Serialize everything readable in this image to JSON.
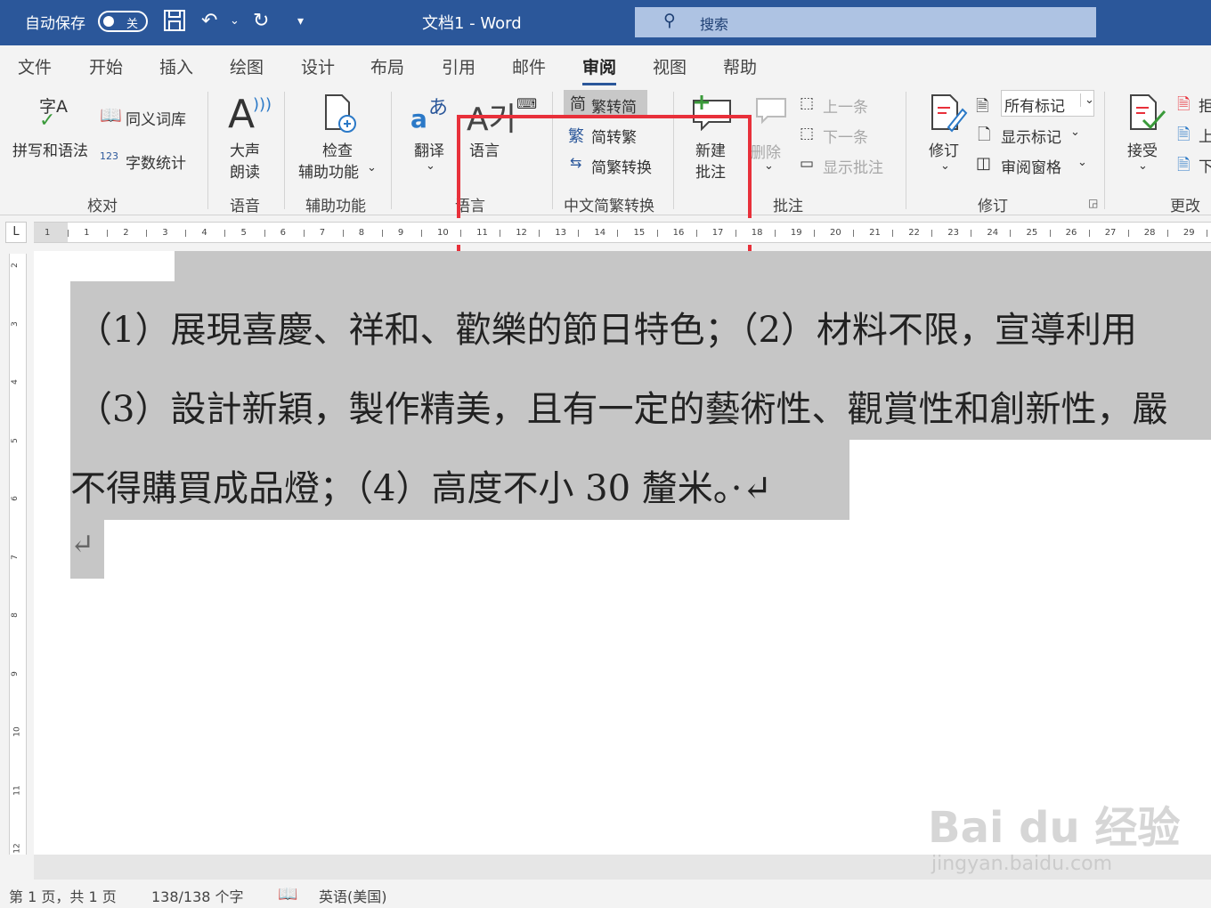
{
  "titlebar": {
    "autosave_label": "自动保存",
    "autosave_state": "关",
    "doc_title": "文档1  -  Word",
    "search_placeholder": "搜索"
  },
  "tabs": [
    "文件",
    "开始",
    "插入",
    "绘图",
    "设计",
    "布局",
    "引用",
    "邮件",
    "审阅",
    "视图",
    "帮助"
  ],
  "active_tab": "审阅",
  "ribbon": {
    "proofing": {
      "spelling": "拼写和语法",
      "spelling_icon_text": "字A",
      "thesaurus": "同义词库",
      "word_count": "字数统计",
      "word_count_icon_text": "123",
      "group": "校对"
    },
    "speech": {
      "read_aloud_1": "大声",
      "read_aloud_2": "朗读",
      "group": "语音"
    },
    "accessibility": {
      "check_1": "检查",
      "check_2": "辅助功能",
      "group": "辅助功能"
    },
    "language": {
      "translate": "翻译",
      "translate_icon_a": "a",
      "translate_icon_b": "あ",
      "language": "语言",
      "language_icon": "A가",
      "group": "语言"
    },
    "chinese": {
      "to_simplified": "繁转简",
      "to_traditional": "简转繁",
      "convert": "简繁转换",
      "icon_simp": "简",
      "icon_trad": "繁",
      "group": "中文简繁转换"
    },
    "comments": {
      "new_1": "新建",
      "new_2": "批注",
      "delete": "删除",
      "prev": "上一条",
      "next": "下一条",
      "show": "显示批注",
      "group": "批注"
    },
    "tracking": {
      "track": "修订",
      "markup_select": "所有标记",
      "show_markup": "显示标记",
      "pane": "审阅窗格",
      "group": "修订"
    },
    "changes": {
      "accept": "接受",
      "reject_partial": "拒",
      "prev_partial": "上",
      "next_partial": "下",
      "group": "更改"
    }
  },
  "ruler": {
    "corner": "L",
    "numbers": [
      "1",
      "1",
      "2",
      "3",
      "4",
      "5",
      "6",
      "7",
      "8",
      "9",
      "10",
      "11",
      "12",
      "13",
      "14",
      "15",
      "16",
      "17",
      "18",
      "19",
      "20",
      "21",
      "22",
      "23",
      "24",
      "25",
      "26",
      "27",
      "28",
      "29"
    ],
    "vnumbers": [
      "2",
      "3",
      "4",
      "5",
      "6",
      "7",
      "8",
      "9",
      "10",
      "11",
      "12"
    ]
  },
  "document": {
    "line1": "（1）展現喜慶、祥和、歡樂的節日特色；（2）材料不限，宣導利用",
    "line2": "（3）設計新穎，製作精美，且有一定的藝術性、觀賞性和創新性，嚴",
    "line3": "不得購買成品燈；（4）高度不小 30 釐米。·↵",
    "line4": "↵"
  },
  "status": {
    "page": "第 1 页，共 1 页",
    "words": "138/138 个字",
    "language": "英语(美国)"
  },
  "watermark": {
    "brand": "Bai du 经验",
    "url": "jingyan.baidu.com"
  },
  "colors": {
    "titlebar": "#2b579a",
    "highlight_box": "#e8303a",
    "selection": "#c6c6c6"
  }
}
